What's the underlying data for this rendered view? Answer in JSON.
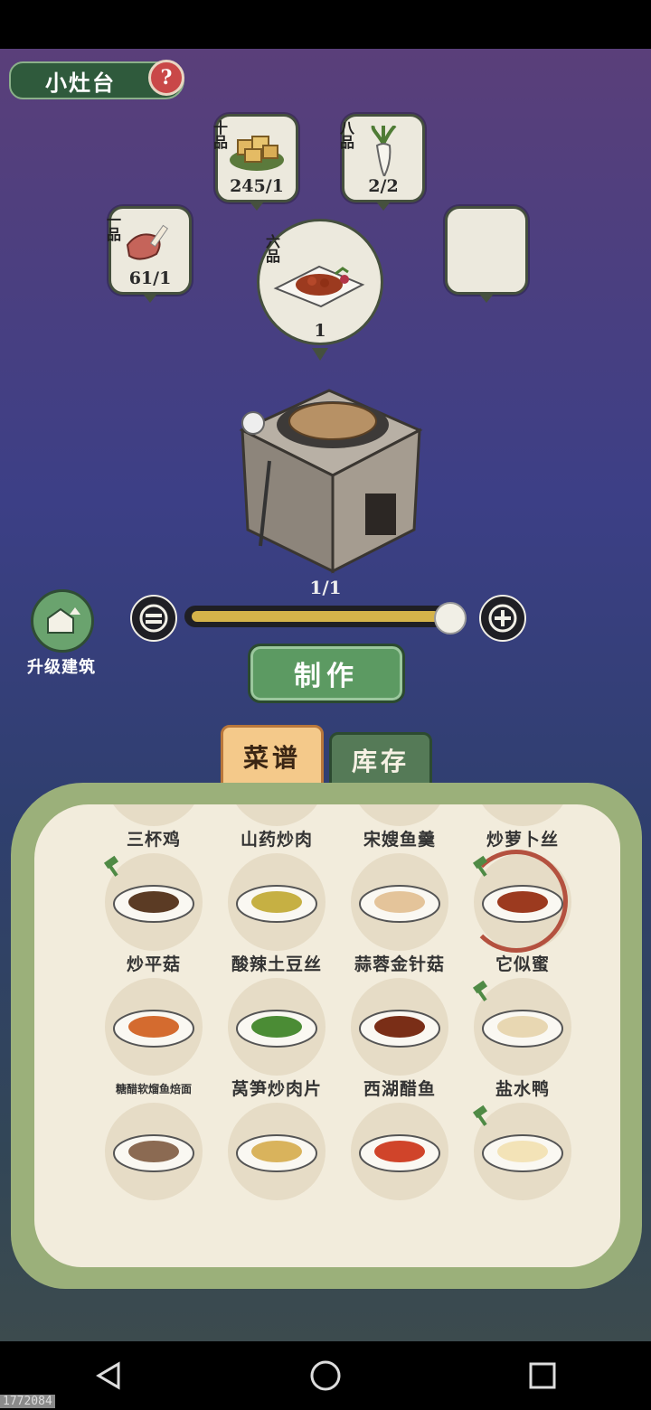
{
  "header": {
    "title": "小灶台",
    "help": "?"
  },
  "ingredients": [
    {
      "grade": "十品",
      "count": "245/1",
      "item": "tofu-icon"
    },
    {
      "grade": "八品",
      "count": "2/2",
      "item": "radish-icon"
    },
    {
      "grade": "一品",
      "count": "61/1",
      "item": "meat-icon"
    },
    {
      "grade": "",
      "count": "",
      "item": "empty-slot"
    }
  ],
  "product": {
    "grade": "六品",
    "count": "1"
  },
  "stove": {
    "count": "1/1"
  },
  "upgrade": {
    "label": "升级建筑"
  },
  "quantity": {
    "fraction": 1.0
  },
  "make_button": {
    "label": "制作"
  },
  "tabs": [
    {
      "label": "菜谱",
      "active": true
    },
    {
      "label": "库存",
      "active": false
    }
  ],
  "recipes": [
    {
      "name": "三杯鸡",
      "hammer": false
    },
    {
      "name": "山药炒肉",
      "hammer": false
    },
    {
      "name": "宋嫂鱼羹",
      "hammer": false
    },
    {
      "name": "炒萝卜丝",
      "hammer": false
    },
    {
      "name": "炒平菇",
      "hammer": true
    },
    {
      "name": "酸辣土豆丝",
      "hammer": false
    },
    {
      "name": "蒜蓉金针菇",
      "hammer": false
    },
    {
      "name": "它似蜜",
      "hammer": true,
      "selected": true
    },
    {
      "name": "糖醋软熘鱼焙面",
      "hammer": false
    },
    {
      "name": "莴笋炒肉片",
      "hammer": false
    },
    {
      "name": "西湖醋鱼",
      "hammer": false
    },
    {
      "name": "盐水鸭",
      "hammer": true
    },
    {
      "name": "",
      "hammer": false
    },
    {
      "name": "",
      "hammer": false
    },
    {
      "name": "",
      "hammer": false
    },
    {
      "name": "",
      "hammer": true
    }
  ],
  "id_label": "1772084",
  "colors": {
    "panel": "#f2ecdc",
    "button": "#5c9a62",
    "tab_active": "#f4c98a"
  }
}
